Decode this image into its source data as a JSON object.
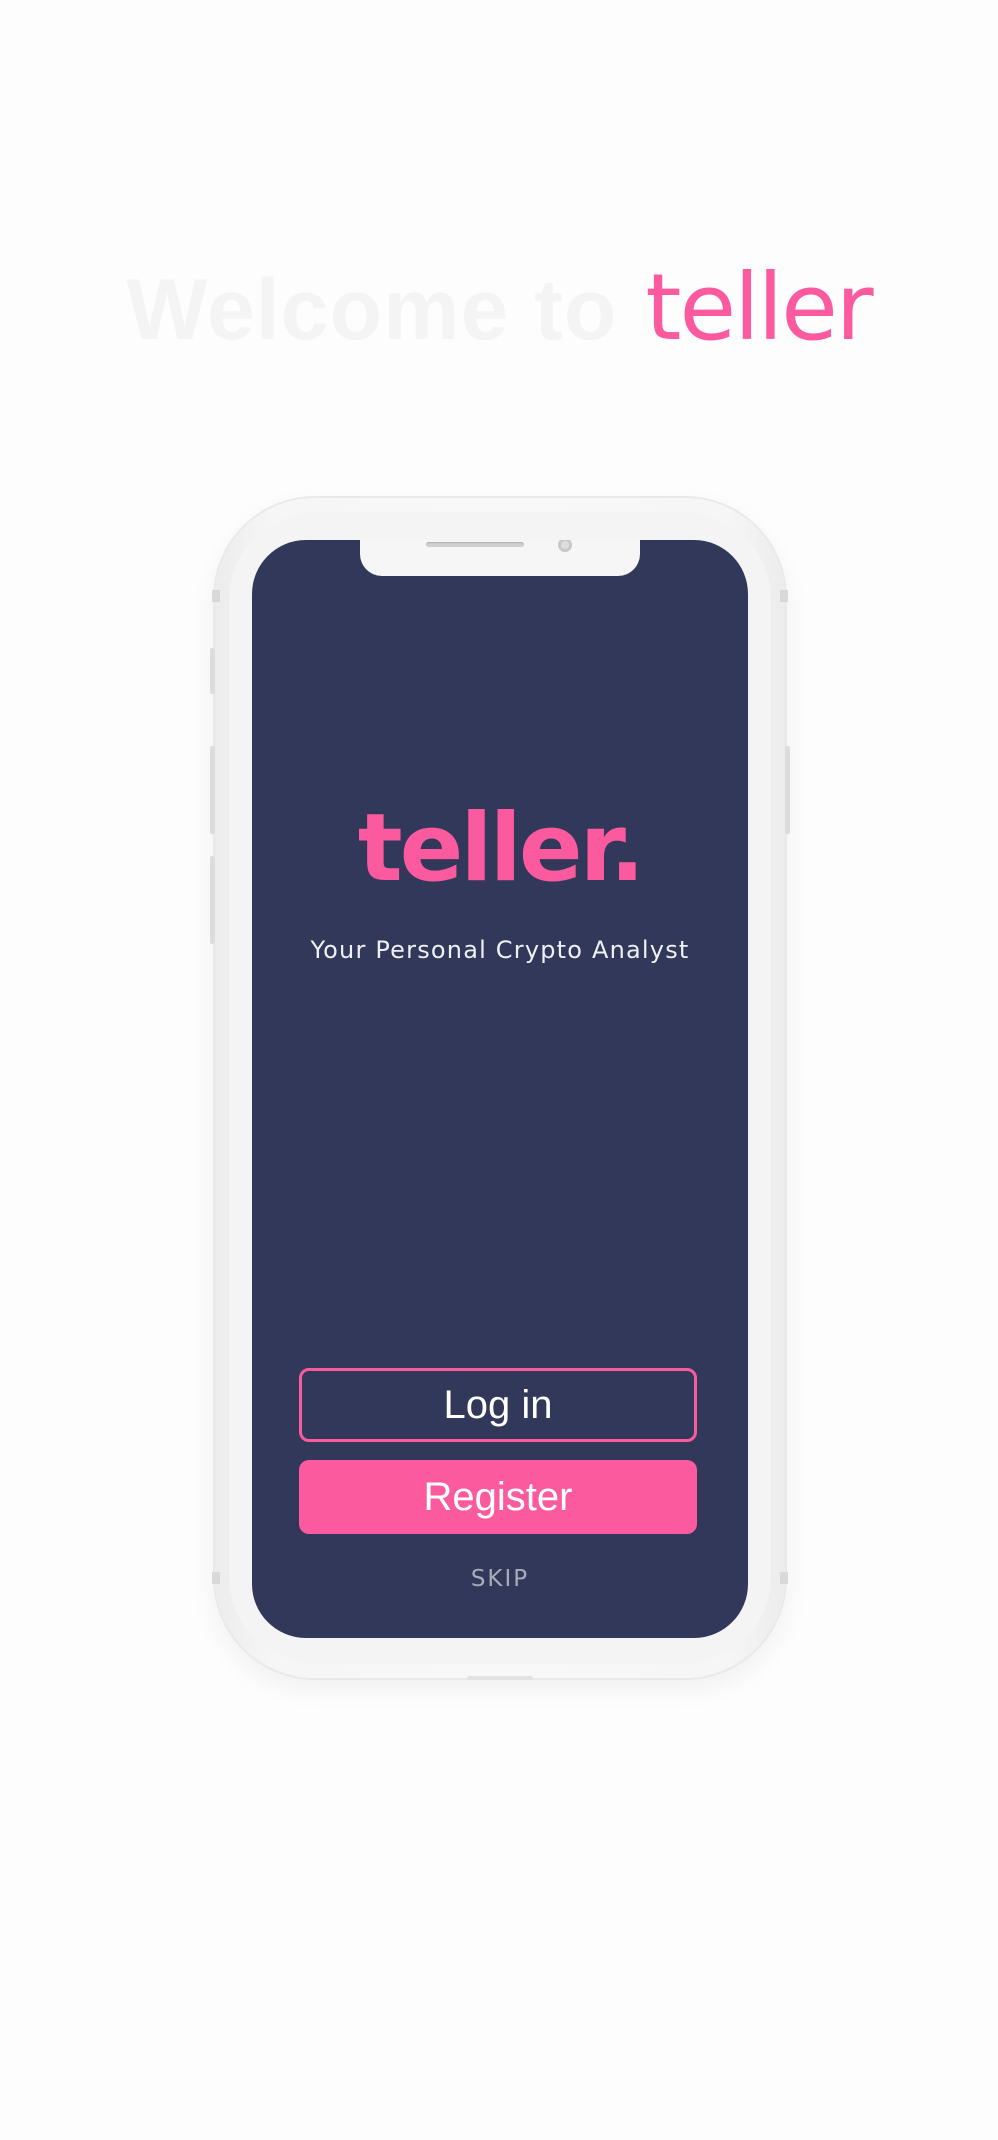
{
  "headline": {
    "prefix": "Welcome to",
    "brand": "teller"
  },
  "app": {
    "logo": "teller.",
    "tagline": "Your Personal Crypto Analyst",
    "login_label": "Log in",
    "register_label": "Register",
    "skip_label": "SKIP"
  },
  "colors": {
    "brand_pink": "#fc5a9f",
    "screen_navy": "#31385a",
    "page_background": "#fdfdfd"
  }
}
